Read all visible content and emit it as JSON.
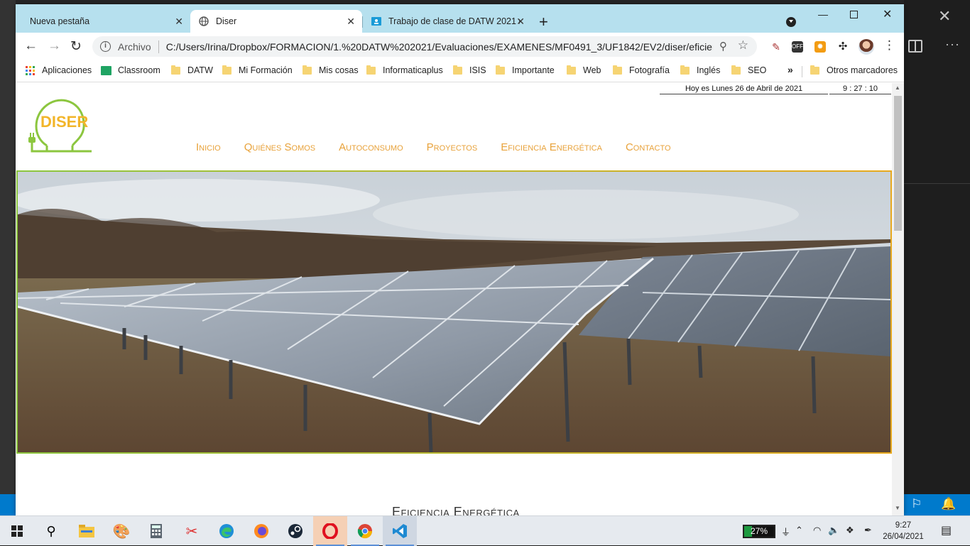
{
  "browser": {
    "tabs": [
      {
        "title": "Nueva pestaña",
        "active": false
      },
      {
        "title": "Diser",
        "active": true
      },
      {
        "title": "Trabajo de clase de DATW 2021 (",
        "active": false
      }
    ],
    "new_tab_label": "+",
    "address": {
      "scheme_label": "Archivo",
      "url": "C:/Users/Irina/Dropbox/FORMACION/1.%20DATW%202021/Evaluaciones/EXAMENES/MF0491_3/UF1842/EV2/diser/eficien..."
    },
    "extensions": [
      {
        "icon": "eyedropper-icon"
      },
      {
        "icon": "off-toggle-icon",
        "label": "OFF"
      },
      {
        "icon": "orange-extension-icon"
      },
      {
        "icon": "puzzle-icon"
      }
    ],
    "bookmarks": [
      {
        "label": "Aplicaciones",
        "icon": "apps-grid-icon"
      },
      {
        "label": "Classroom",
        "icon": "classroom-icon"
      },
      {
        "label": "DATW",
        "icon": "folder-icon"
      },
      {
        "label": "Mi Formación",
        "icon": "folder-icon"
      },
      {
        "label": "Mis cosas",
        "icon": "folder-icon"
      },
      {
        "label": "Informaticaplus",
        "icon": "folder-icon"
      },
      {
        "label": "ISIS",
        "icon": "folder-icon"
      },
      {
        "label": "Importante",
        "icon": "folder-icon"
      },
      {
        "label": "Web",
        "icon": "folder-icon"
      },
      {
        "label": "Fotografía",
        "icon": "folder-icon"
      },
      {
        "label": "Inglés",
        "icon": "folder-icon"
      },
      {
        "label": "SEO",
        "icon": "folder-icon"
      }
    ],
    "bookmarks_overflow": "»",
    "other_bookmarks": "Otros marcadores"
  },
  "page": {
    "date_text": "Hoy es Lunes 26 de Abril de 2021",
    "clock_text": "9 : 27 : 10",
    "logo_text": "DISER",
    "nav": [
      "Inicio",
      "Quiénes Somos",
      "Autoconsumo",
      "Proyectos",
      "Eficiencia Energética",
      "Contacto"
    ],
    "section_title": "Eficiencia Energética",
    "colors": {
      "green": "#8cc63f",
      "orange": "#e8a23a"
    }
  },
  "taskbar": {
    "apps": [
      "windows-start-icon",
      "search-icon",
      "file-explorer-icon",
      "paint-icon",
      "calculator-icon",
      "snipping-icon",
      "edge-icon",
      "firefox-icon",
      "steam-icon",
      "opera-icon",
      "chrome-icon",
      "vscode-icon"
    ],
    "battery_percent": "27%",
    "battery_level": 0.27,
    "time": "9:27",
    "date": "26/04/2021"
  }
}
